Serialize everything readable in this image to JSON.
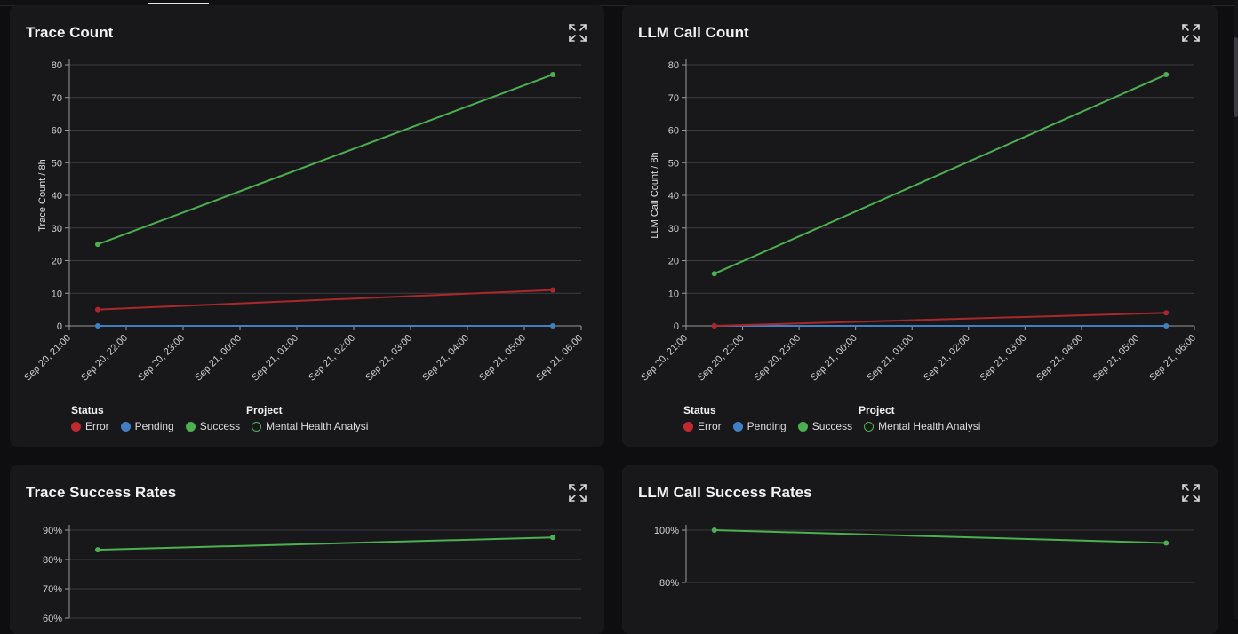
{
  "icons": {
    "expand": "expand-icon"
  },
  "colors": {
    "error": "#c2292e",
    "pending": "#3f7fc2",
    "success": "#4caf50",
    "error_line": "#a8282c",
    "grid": "#3c3c42",
    "axis_text": "#cfcfcf"
  },
  "chart_data": [
    {
      "type": "line",
      "title": "Trace Count",
      "ylabel": "Trace Count / 8h",
      "ylim": [
        0,
        80
      ],
      "yticks": [
        0,
        10,
        20,
        30,
        40,
        50,
        60,
        70,
        80
      ],
      "x_ticks": [
        "Sep 20, 21:00",
        "Sep 20, 22:00",
        "Sep 20, 23:00",
        "Sep 21, 00:00",
        "Sep 21, 01:00",
        "Sep 21, 02:00",
        "Sep 21, 03:00",
        "Sep 21, 04:00",
        "Sep 21, 05:00",
        "Sep 21, 06:00"
      ],
      "x_range": [
        "Sep 20, 21:00",
        "Sep 21, 06:00"
      ],
      "x": [
        "Sep 20, 21:30",
        "Sep 21, 05:30"
      ],
      "series": [
        {
          "name": "Success",
          "values": [
            25,
            77
          ]
        },
        {
          "name": "Error",
          "values": [
            5,
            11
          ]
        },
        {
          "name": "Pending",
          "values": [
            0,
            0
          ]
        }
      ],
      "grid": true,
      "legend": {
        "position": "bottom-left",
        "status_header": "Status",
        "project_header": "Project",
        "status_items": [
          "Error",
          "Pending",
          "Success"
        ],
        "project_items": [
          "Mental Health Analysi"
        ]
      }
    },
    {
      "type": "line",
      "title": "LLM Call Count",
      "ylabel": "LLM Call Count / 8h",
      "ylim": [
        0,
        80
      ],
      "yticks": [
        0,
        10,
        20,
        30,
        40,
        50,
        60,
        70,
        80
      ],
      "x_ticks": [
        "Sep 20, 21:00",
        "Sep 20, 22:00",
        "Sep 20, 23:00",
        "Sep 21, 00:00",
        "Sep 21, 01:00",
        "Sep 21, 02:00",
        "Sep 21, 03:00",
        "Sep 21, 04:00",
        "Sep 21, 05:00",
        "Sep 21, 06:00"
      ],
      "x_range": [
        "Sep 20, 21:00",
        "Sep 21, 06:00"
      ],
      "x": [
        "Sep 20, 21:30",
        "Sep 21, 05:30"
      ],
      "series": [
        {
          "name": "Success",
          "values": [
            16,
            77
          ]
        },
        {
          "name": "Error",
          "values": [
            0,
            4
          ]
        },
        {
          "name": "Pending",
          "values": [
            0,
            0
          ]
        }
      ],
      "grid": true,
      "legend": {
        "position": "bottom-left",
        "status_header": "Status",
        "project_header": "Project",
        "status_items": [
          "Error",
          "Pending",
          "Success"
        ],
        "project_items": [
          "Mental Health Analysi"
        ]
      }
    },
    {
      "type": "line",
      "title": "Trace Success Rates",
      "ylabel": "",
      "yticks": [
        60,
        70,
        80,
        90
      ],
      "ytick_labels": [
        "60%",
        "70%",
        "80%",
        "90%"
      ],
      "ylim": [
        60,
        90
      ],
      "x_range": [
        "Sep 20, 21:00",
        "Sep 21, 06:00"
      ],
      "x": [
        "Sep 20, 21:30",
        "Sep 21, 05:30"
      ],
      "series": [
        {
          "name": "Success",
          "values": [
            83.3,
            87.5
          ]
        }
      ],
      "grid": true
    },
    {
      "type": "line",
      "title": "LLM Call Success Rates",
      "ylabel": "",
      "yticks": [
        80,
        100
      ],
      "ytick_labels": [
        "80%",
        "100%"
      ],
      "ylim": [
        80,
        100
      ],
      "x_range": [
        "Sep 20, 21:00",
        "Sep 21, 06:00"
      ],
      "x": [
        "Sep 20, 21:30",
        "Sep 21, 05:30"
      ],
      "series": [
        {
          "name": "Success",
          "values": [
            100,
            95.1
          ]
        }
      ],
      "grid": true
    }
  ]
}
